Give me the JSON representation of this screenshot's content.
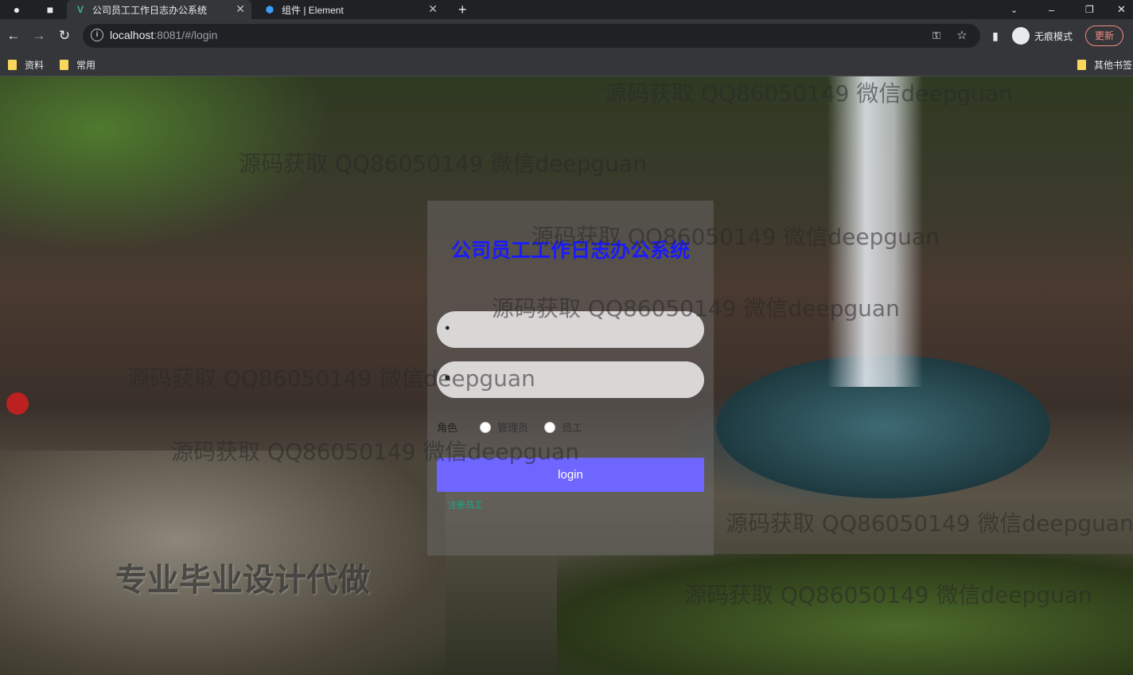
{
  "browser": {
    "tabs": [
      {
        "title": "公司员工工作日志办公系统",
        "icon": "vue-icon",
        "active": true
      },
      {
        "title": "组件 | Element",
        "icon": "element-icon",
        "active": false
      }
    ],
    "url_host": "localhost",
    "url_rest": ":8081/#/login",
    "incognito_label": "无痕模式",
    "update_label": "更新",
    "bookmarks": [
      "资料",
      "常用"
    ],
    "other_bookmarks": "其他书签"
  },
  "login": {
    "title": "公司员工工作日志办公系统",
    "role_label": "角色",
    "roles": [
      "管理员",
      "员工"
    ],
    "login_button": "login",
    "register_link": "注册员工"
  },
  "overlay": {
    "watermark": "源码获取 QQ86050149 微信deepguan",
    "promo": "专业毕业设计代做"
  },
  "colors": {
    "title": "#1a1aff",
    "login_button": "#6f65ff",
    "register_link": "#1aaa8c"
  }
}
